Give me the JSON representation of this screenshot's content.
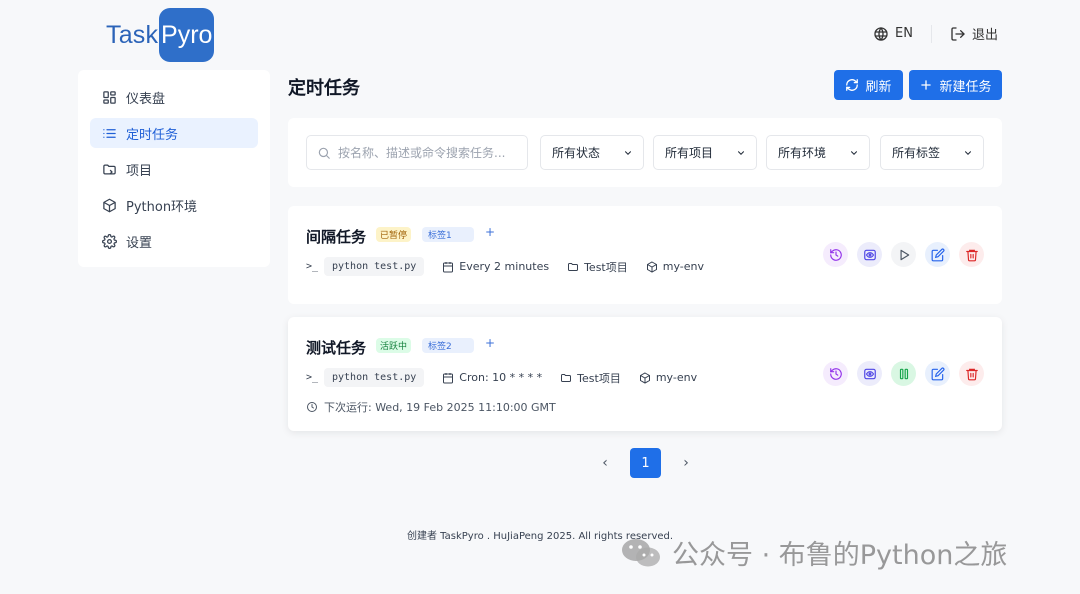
{
  "brand": {
    "part1": "Task",
    "part2": "Pyro"
  },
  "header": {
    "language": "EN",
    "logout": "退出"
  },
  "sidebar": {
    "items": [
      {
        "label": "仪表盘",
        "icon": "dashboard-icon"
      },
      {
        "label": "定时任务",
        "icon": "list-icon",
        "active": true
      },
      {
        "label": "项目",
        "icon": "folder-icon"
      },
      {
        "label": "Python环境",
        "icon": "cube-icon"
      },
      {
        "label": "设置",
        "icon": "gear-icon"
      }
    ]
  },
  "main": {
    "title": "定时任务",
    "refresh_label": "刷新",
    "new_task_label": "新建任务",
    "search_placeholder": "按名称、描述或命令搜索任务...",
    "filters": {
      "status": "所有状态",
      "project": "所有项目",
      "env": "所有环境",
      "tag": "所有标签"
    }
  },
  "tasks": [
    {
      "name": "间隔任务",
      "status": "已暂停",
      "tag": "标签1",
      "add": "+",
      "command": "python test.py",
      "schedule": "Every 2 minutes",
      "project": "Test项目",
      "env": "my-env",
      "prompt": ">_"
    },
    {
      "name": "测试任务",
      "status": "活跃中",
      "tag": "标签2",
      "add": "+",
      "command": "python test.py",
      "schedule": "Cron: 10 * * * *",
      "project": "Test项目",
      "env": "my-env",
      "prompt": ">_",
      "next_run": "下次运行: Wed, 19 Feb 2025 11:10:00 GMT"
    }
  ],
  "pagination": {
    "current": "1",
    "prev": "‹",
    "next": "›"
  },
  "footer": "创建者 TaskPyro . HuJiaPeng 2025. All rights reserved.",
  "watermark": "公众号 · 布鲁的Python之旅",
  "colors": {
    "primary": "#1f6fe8",
    "brand": "#2f6fc9",
    "background": "#f7f8fa"
  }
}
